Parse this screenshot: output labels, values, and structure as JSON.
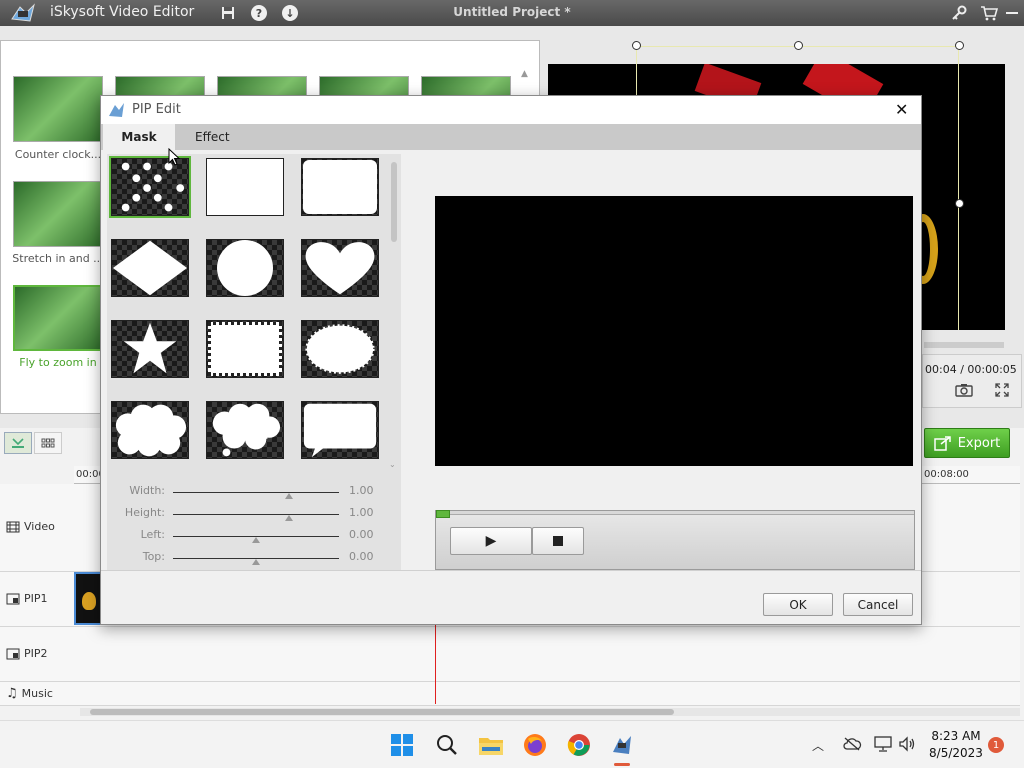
{
  "app": {
    "title": "iSkysoft Video Editor",
    "project": "Untitled Project *"
  },
  "effects": {
    "captions": [
      "Counter clock...",
      "Stretch in and ...",
      "Fly to zoom in"
    ]
  },
  "player": {
    "time": "00:04 / 00:00:05"
  },
  "export": {
    "label": "Export"
  },
  "timeline": {
    "ruler_start": "00:00",
    "ruler_end": "00:08:00",
    "tracks": [
      "Video",
      "PIP1",
      "PIP2",
      "Music"
    ]
  },
  "dialog": {
    "title": "PIP Edit",
    "tabs": [
      "Mask",
      "Effect"
    ],
    "sliders": [
      {
        "label": "Width:",
        "value": "1.00",
        "level": 1.0
      },
      {
        "label": "Height:",
        "value": "1.00",
        "level": 1.0
      },
      {
        "label": "Left:",
        "value": "0.00",
        "level": 0.5
      },
      {
        "label": "Top:",
        "value": "0.00",
        "level": 0.5
      }
    ],
    "ok": "OK",
    "cancel": "Cancel"
  },
  "taskbar": {
    "time": "8:23 AM",
    "date": "8/5/2023",
    "badge": "1"
  },
  "colors": {
    "accent_green": "#5fb73d",
    "export_green": "#4bb52d"
  }
}
